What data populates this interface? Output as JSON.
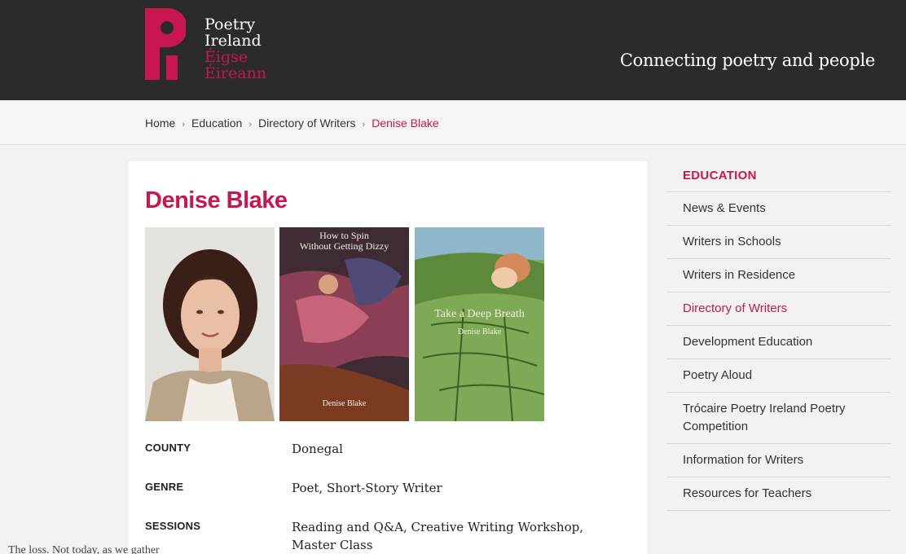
{
  "header": {
    "logo_en_line1": "Poetry",
    "logo_en_line2": "Ireland",
    "logo_ga_line1": "Éigse",
    "logo_ga_line2": "Éireann",
    "tagline": "Connecting poetry and people"
  },
  "breadcrumb": {
    "items": [
      "Home",
      "Education",
      "Directory of Writers"
    ],
    "current": "Denise Blake",
    "separator": "›"
  },
  "main": {
    "title": "Denise Blake",
    "book1": {
      "title_line1": "How to Spin",
      "title_line2": "Without Getting Dizzy",
      "author": "Denise Blake"
    },
    "book2": {
      "title": "Take a Deep Breath",
      "author": "Denise Blake"
    },
    "info": [
      {
        "label": "COUNTY",
        "value": "Donegal"
      },
      {
        "label": "GENRE",
        "value": "Poet, Short-Story Writer"
      },
      {
        "label": "SESSIONS",
        "value": "Reading and Q&A, Creative Writing Workshop, Master Class"
      }
    ]
  },
  "sidebar": {
    "heading": "EDUCATION",
    "items": [
      {
        "label": "News & Events",
        "active": false
      },
      {
        "label": "Writers in Schools",
        "active": false
      },
      {
        "label": "Writers in Residence",
        "active": false
      },
      {
        "label": "Directory of Writers",
        "active": true
      },
      {
        "label": "Development Education",
        "active": false
      },
      {
        "label": "Poetry Aloud",
        "active": false
      },
      {
        "label": "Trócaire Poetry Ireland Poetry Competition",
        "active": false
      },
      {
        "label": "Information for Writers",
        "active": false
      },
      {
        "label": "Resources for Teachers",
        "active": false
      }
    ]
  },
  "overflow_text": "The loss. Not today, as we gather",
  "colors": {
    "accent": "#c8164f",
    "header_bg": "#2b2b2b"
  }
}
